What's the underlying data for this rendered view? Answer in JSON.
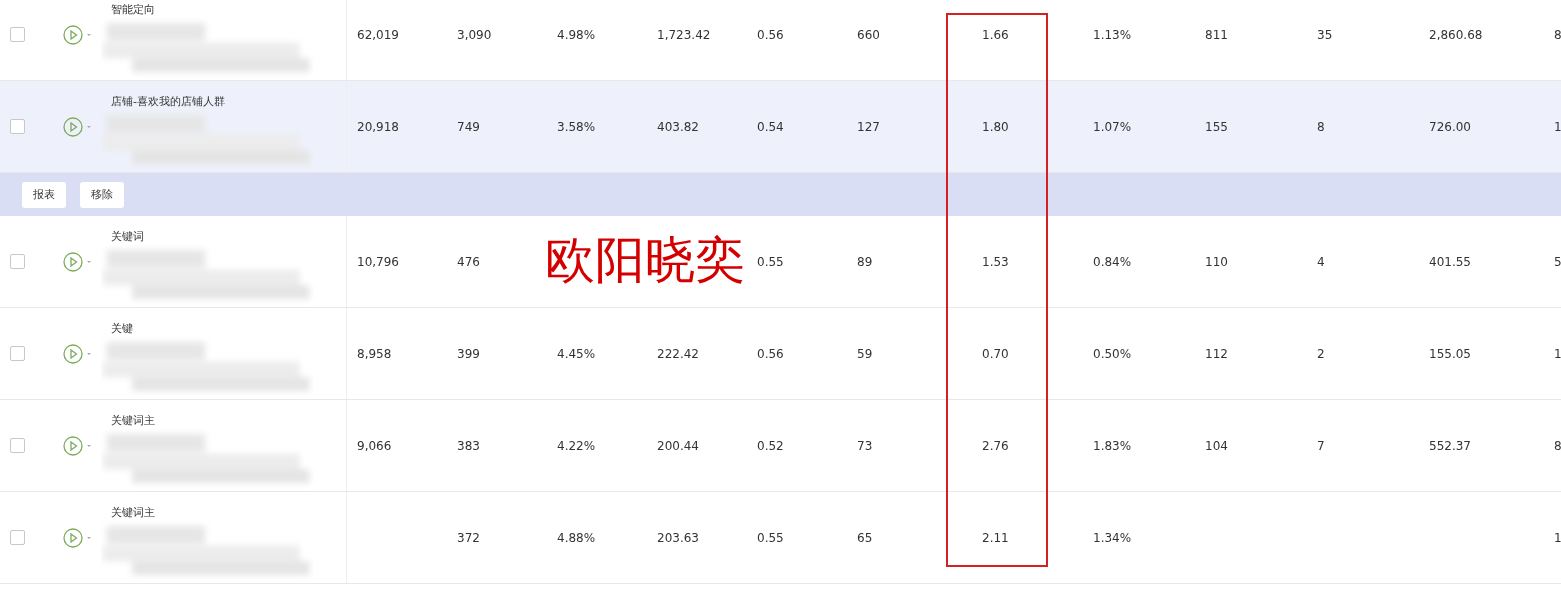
{
  "columns": [
    {
      "highlighted": false
    },
    {
      "highlighted": false
    },
    {
      "highlighted": false
    },
    {
      "highlighted": false
    },
    {
      "highlighted": false
    },
    {
      "highlighted": false
    },
    {
      "highlighted": true
    },
    {
      "highlighted": false
    },
    {
      "highlighted": false
    },
    {
      "highlighted": false
    },
    {
      "highlighted": false
    },
    {
      "highlighted": false
    }
  ],
  "rows_top": [
    {
      "name": "智能定向",
      "checked": false,
      "selected": false,
      "cells": [
        "62,019",
        "3,090",
        "4.98%",
        "1,723.42",
        "0.56",
        "660",
        "1.66",
        "1.13%",
        "811",
        "35",
        "2,860.68",
        "8"
      ]
    },
    {
      "name": "店铺-喜欢我的店铺人群",
      "checked": false,
      "selected": true,
      "cells": [
        "20,918",
        "749",
        "3.58%",
        "403.82",
        "0.54",
        "127",
        "1.80",
        "1.07%",
        "155",
        "8",
        "726.00",
        "1"
      ]
    }
  ],
  "action_bar": {
    "buttons": [
      "报表",
      "移除"
    ]
  },
  "rows_bottom": [
    {
      "name": "关键词",
      "checked": false,
      "selected": false,
      "cells": [
        "10,796",
        "476",
        null,
        null,
        "0.55",
        "89",
        "1.53",
        "0.84%",
        "110",
        "4",
        "401.55",
        "5"
      ]
    },
    {
      "name": "关键",
      "checked": false,
      "selected": false,
      "cells": [
        "8,958",
        "399",
        "4.45%",
        "222.42",
        "0.56",
        "59",
        "0.70",
        "0.50%",
        "112",
        "2",
        "155.05",
        "1"
      ]
    },
    {
      "name": "关键词主",
      "checked": false,
      "selected": false,
      "cells": [
        "9,066",
        "383",
        "4.22%",
        "200.44",
        "0.52",
        "73",
        "2.76",
        "1.83%",
        "104",
        "7",
        "552.37",
        "8"
      ]
    },
    {
      "name": "关键词主",
      "checked": false,
      "selected": false,
      "cells": [
        null,
        "372",
        "4.88%",
        "203.63",
        "0.55",
        "65",
        "2.11",
        "1.34%",
        null,
        null,
        null,
        "1"
      ]
    }
  ],
  "annotation": {
    "text": "欧阳晓奕"
  }
}
